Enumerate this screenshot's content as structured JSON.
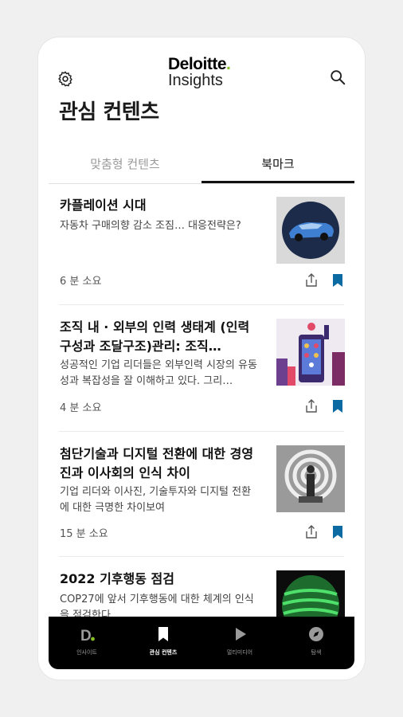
{
  "header": {
    "logo_main": "Deloitte",
    "logo_dot": ".",
    "logo_sub": "Insights"
  },
  "page_title": "관심 컨텐츠",
  "tabs": [
    {
      "label": "맞춤형 컨텐츠",
      "active": false
    },
    {
      "label": "북마크",
      "active": true
    }
  ],
  "articles": [
    {
      "title": "카플레이션 시대",
      "summary": "자동차 구매의향 감소 조짐… 대응전략은?",
      "read_time": "6 분 소요",
      "thumb_icon": "blue-car-thumbnail"
    },
    {
      "title": "조직 내 · 외부의 인력 생태계 (인력구성과 조달구조)관리: 조직…",
      "summary": "성공적인 기업 리더들은 외부인력 시장의 유동성과 복잡성을 잘 이해하고 있다. 그리…",
      "read_time": "4 분 소요",
      "thumb_icon": "city-smartphone-thumbnail"
    },
    {
      "title": "첨단기술과 디지털 전환에 대한 경영진과 이사회의 인식 차이",
      "summary": "기업 리더와 이사진, 기술투자와 디지털 전환에 대한 극명한 차이보여",
      "read_time": "15 분 소요",
      "thumb_icon": "target-figure-thumbnail"
    },
    {
      "title": "2022 기후행동 점검",
      "summary": "COP27에 앞서 기후행동에 대한 체계의 인식을 점검한다",
      "read_time": "",
      "thumb_icon": "green-globe-thumbnail"
    }
  ],
  "bottom_nav": [
    {
      "label": "인사이트",
      "icon": "deloitte-d-icon",
      "active": false
    },
    {
      "label": "관심 컨텐츠",
      "icon": "bookmark-icon",
      "active": true
    },
    {
      "label": "멀티미디어",
      "icon": "play-icon",
      "active": false
    },
    {
      "label": "탐색",
      "icon": "compass-icon",
      "active": false
    }
  ],
  "colors": {
    "accent_bookmark": "#0a6aa1",
    "brand_green": "#86bc25",
    "nav_background": "#000000"
  }
}
